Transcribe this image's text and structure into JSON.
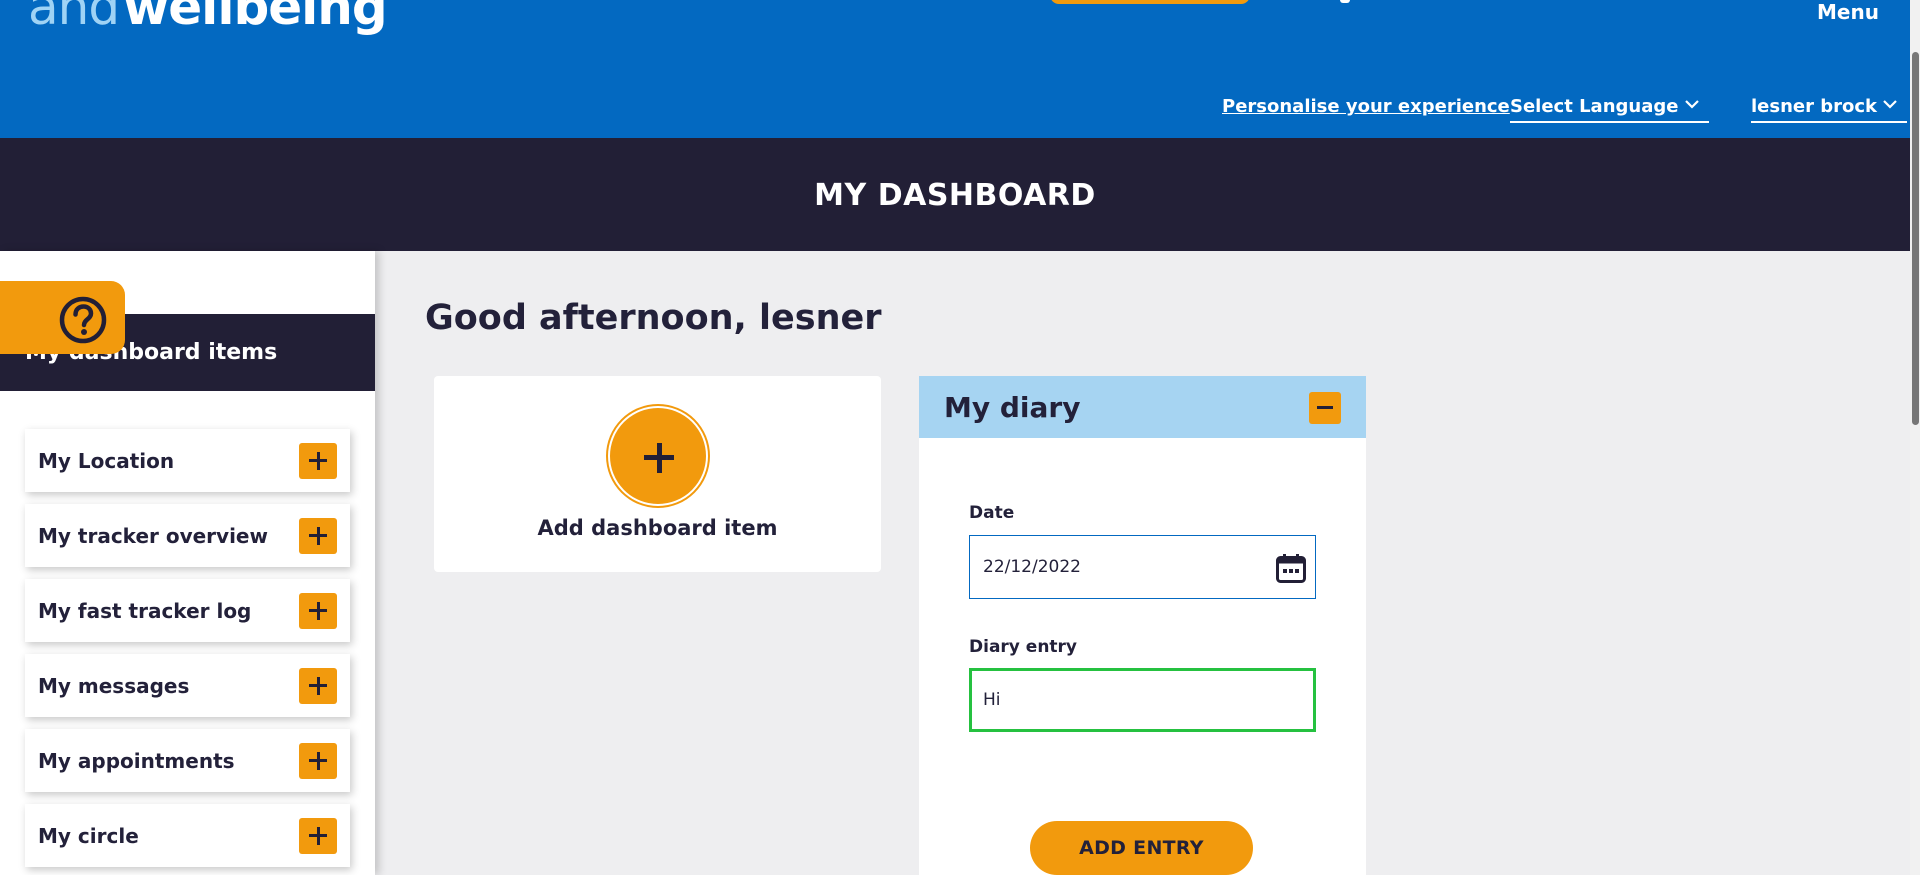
{
  "header": {
    "logo_and": "and",
    "logo_wellbeing": "wellbeing",
    "menu_label": "Menu",
    "personalise_label": "Personalise your experience",
    "language_label": "Select Language",
    "user_label": "lesner brock"
  },
  "page": {
    "title": "MY DASHBOARD",
    "greeting": "Good afternoon, lesner"
  },
  "sidebar": {
    "title": "My dashboard items",
    "items": [
      {
        "label": "My Location"
      },
      {
        "label": "My tracker overview"
      },
      {
        "label": "My fast tracker log"
      },
      {
        "label": "My messages"
      },
      {
        "label": "My appointments"
      },
      {
        "label": "My circle"
      }
    ]
  },
  "add_card": {
    "label": "Add dashboard item"
  },
  "diary": {
    "title": "My diary",
    "date_label": "Date",
    "date_value": "22/12/2022",
    "entry_label": "Diary entry",
    "entry_value": "Hi",
    "button_label": "ADD ENTRY"
  },
  "icons": {
    "help": "help-icon",
    "calendar": "calendar-icon",
    "chevron": "chevron-down-icon"
  },
  "colors": {
    "brand_blue": "#0369c1",
    "dark_navy": "#221f36",
    "accent_orange": "#f29a0d",
    "diary_header": "#a6d4f2",
    "focus_green": "#25c140"
  }
}
